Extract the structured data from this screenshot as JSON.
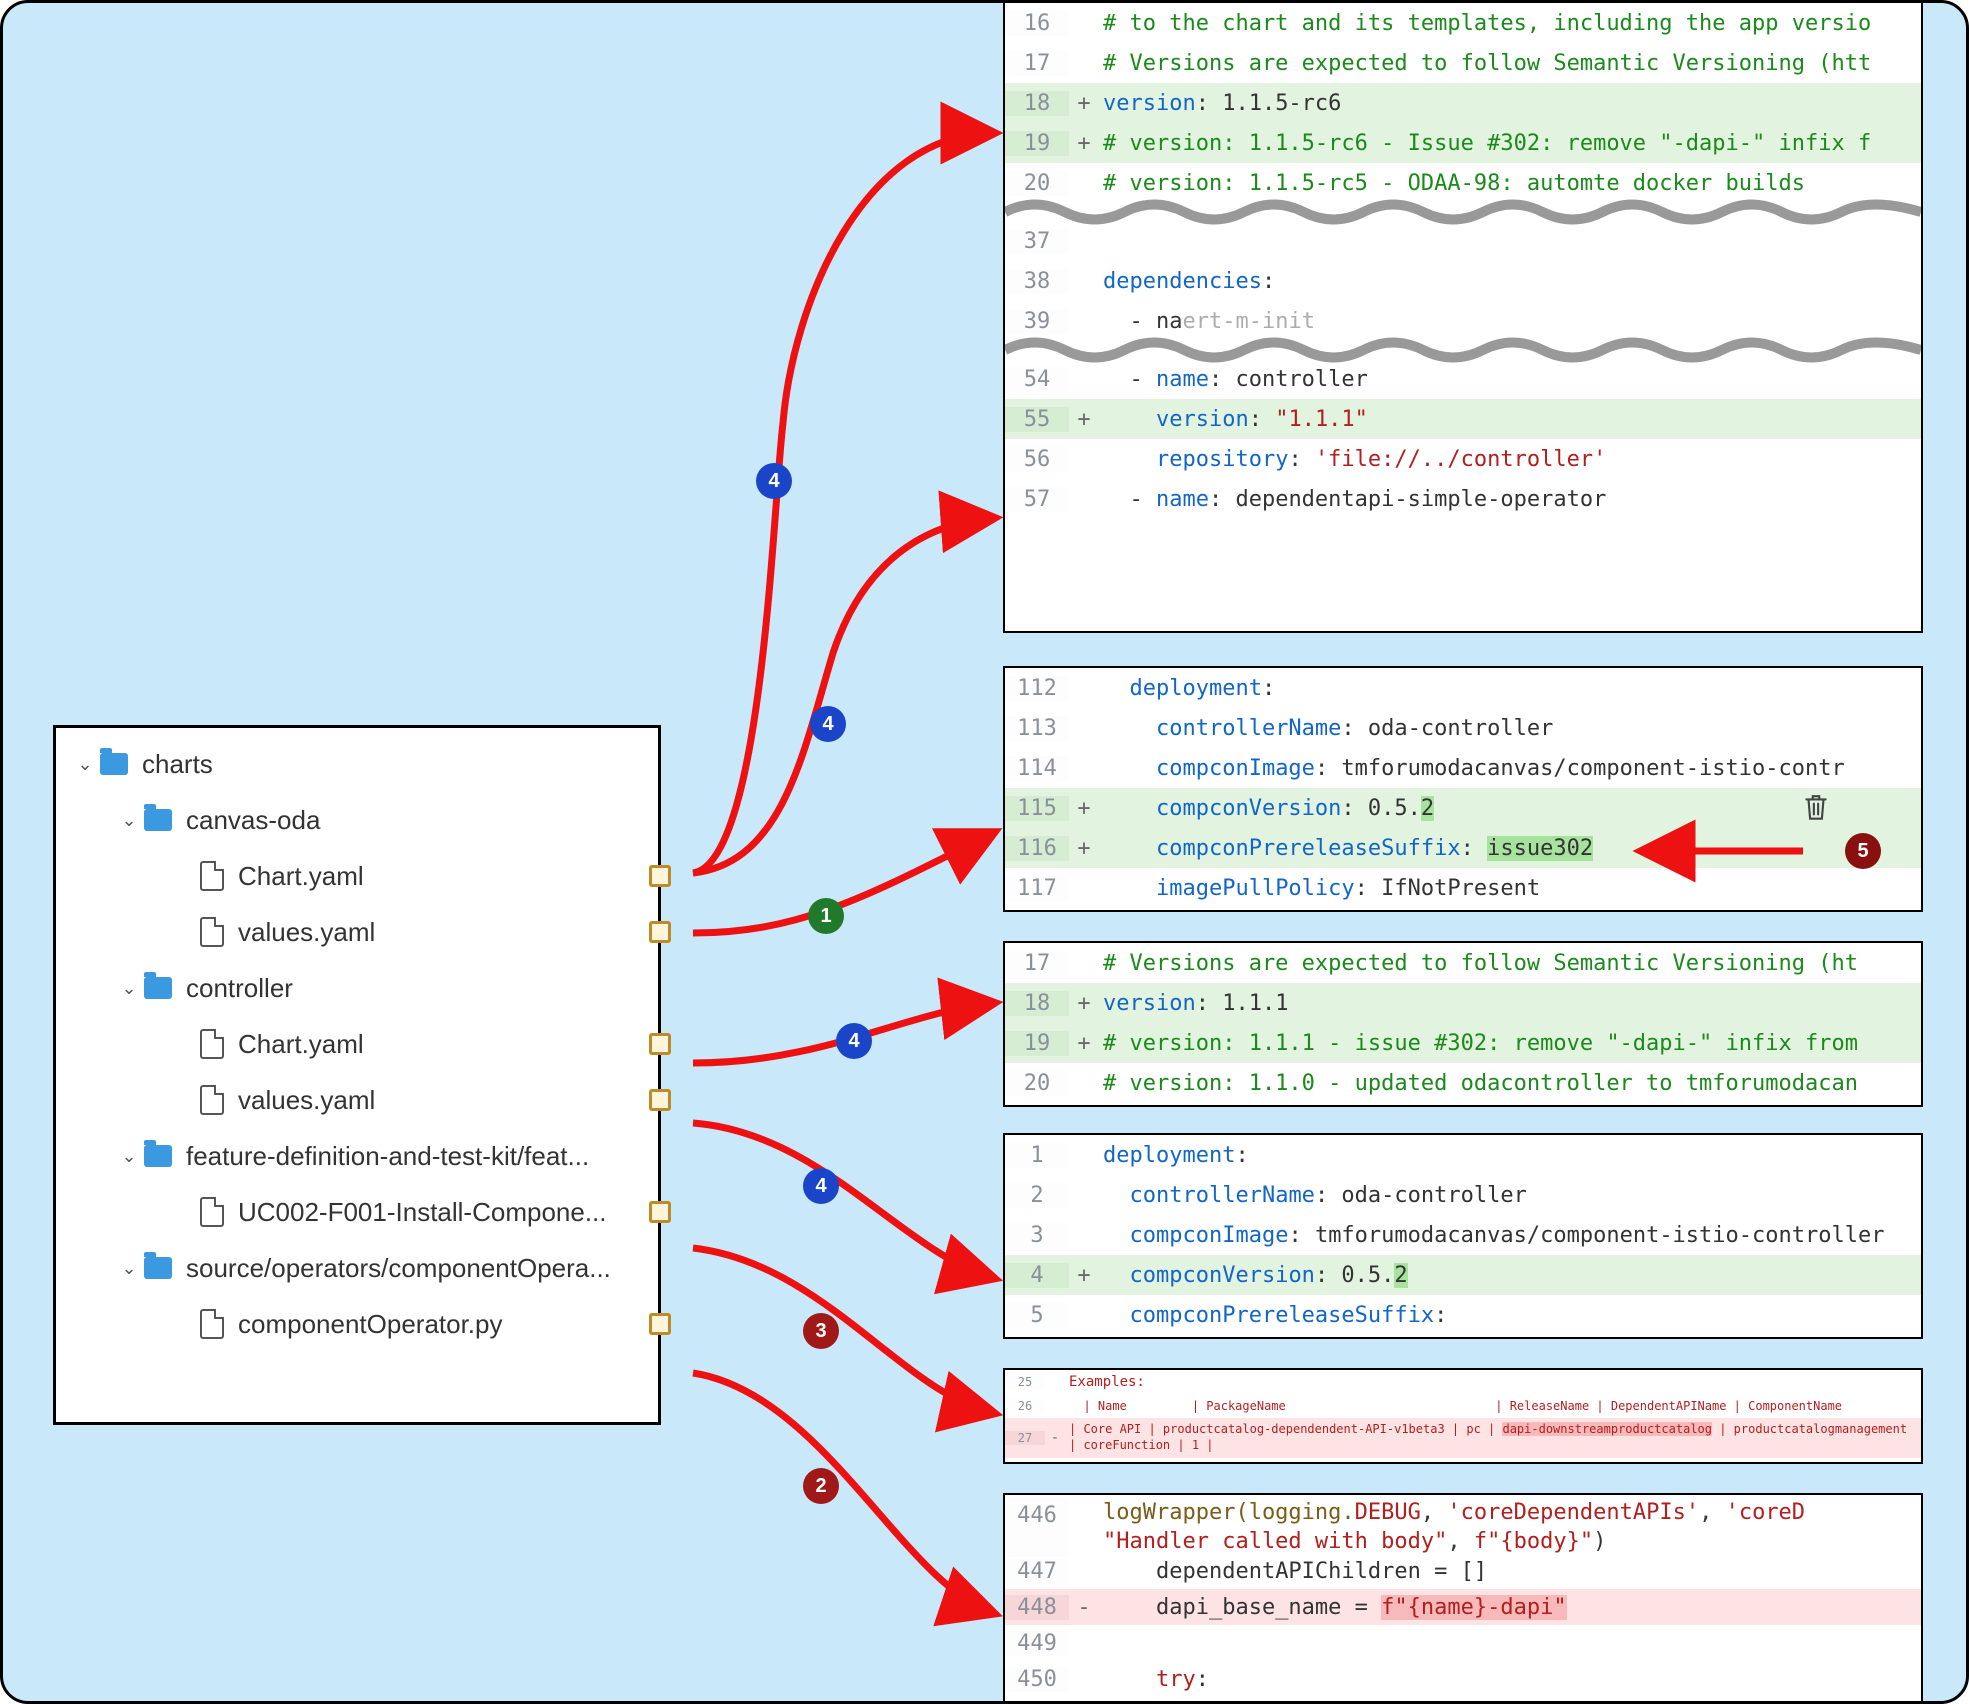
{
  "tree": {
    "root": "charts",
    "canvas_oda": "canvas-oda",
    "chart_yaml": "Chart.yaml",
    "values_yaml": "values.yaml",
    "controller": "controller",
    "feature_kit": "feature-definition-and-test-kit/feat...",
    "uc002": "UC002-F001-Install-Compone...",
    "source_ops": "source/operators/componentOpera...",
    "comp_operator": "componentOperator.py"
  },
  "p1": {
    "l16": "# to the chart and its templates, including the app versio",
    "l17": "# Versions are expected to follow Semantic Versioning (htt",
    "l18_k": "version",
    "l18_v": ": 1.1.5-rc6",
    "l19": "# version: 1.1.5-rc6 - Issue #302: remove \"-dapi-\" infix f",
    "l20": "# version: 1.1.5-rc5 - ODAA-98: automte docker builds",
    "ln37": "37",
    "l38_k": "dependencies",
    "l38_v": ":",
    "l39_a": "  - na",
    "l39_b": "ert-m",
    "l39_c": "-init",
    "ln54": "54",
    "l54_a": "  - ",
    "l54_k": "name",
    "l54_v": ": controller",
    "l55_k": "version",
    "l55_v": ": ",
    "l55_s": "\"1.1.1\"",
    "l56_k": "repository",
    "l56_v": ": ",
    "l56_s": "'file://../controller'",
    "l57_a": "  - ",
    "l57_k": "name",
    "l57_v": ": dependentapi-simple-operator"
  },
  "p2": {
    "l112_k": "deployment",
    "l112_v": ":",
    "l113_k": "controllerName",
    "l113_v": ": oda-controller",
    "l114_k": "compconImage",
    "l114_v": ": tmforumodacanvas/component-istio-contr",
    "l115_k": "compconVersion",
    "l115_v": ": 0.5.",
    "l115_h": "2",
    "l116_k": "compconPrereleaseSuffix",
    "l116_v": ": ",
    "l116_h": "issue302",
    "l117_k": "imagePullPolicy",
    "l117_v": ": IfNotPresent"
  },
  "p3": {
    "l17": "# Versions are expected to follow Semantic Versioning (ht",
    "l18_k": "version",
    "l18_v": ": 1.1.1",
    "l19": "# version: 1.1.1 - issue #302: remove \"-dapi-\" infix from",
    "l20": "# version: 1.1.0 - updated odacontroller to tmforumodacan"
  },
  "p4": {
    "l1_k": "deployment",
    "l1_v": ":",
    "l2_k": "controllerName",
    "l2_v": ": oda-controller",
    "l3_k": "compconImage",
    "l3_v": ": tmforumodacanvas/component-istio-controller",
    "l4_k": "compconVersion",
    "l4_v": ": 0.5.",
    "l4_h": "2",
    "l5_k": "compconPrereleaseSuffix",
    "l5_v": ":"
  },
  "p5": {
    "l25": "Examples:",
    "l26": "  | Name         | PackageName                             | ReleaseName | DependentAPIName | ComponentName            | SegmentName                 | DependentApiCount |",
    "l27a": "  | Core API     | productcatalog-dependendent-API-v1beta3 |    pc       | ",
    "l27h1": "dapi-",
    "l27h2": "downstreamproductcatalog",
    "l27b": " | productcatalogmanagement     | coreFunction      |   1    |"
  },
  "p6": {
    "l446a": "logWrapper(logging.",
    "l446b": "DEBUG",
    "l446c": ", ",
    "l446d": "'coreDependentAPIs'",
    "l446e": ", ",
    "l446f": "'coreD",
    "l446g": "\"Handler called with body\"",
    "l446h": ", ",
    "l446i": "f\"{body}\"",
    "l446j": ")",
    "l447": "dependentAPIChildren = []",
    "l448a": "dapi_base_name = ",
    "l448b": "f\"{name}-dapi\"",
    "l450": "try",
    "l450b": ":"
  },
  "ln": {
    "p1": [
      "16",
      "17",
      "18",
      "19",
      "20",
      "37",
      "38",
      "39",
      "54",
      "55",
      "56",
      "57"
    ],
    "p2": [
      "112",
      "113",
      "114",
      "115",
      "116",
      "117"
    ],
    "p3": [
      "17",
      "18",
      "19",
      "20"
    ],
    "p4": [
      "1",
      "2",
      "3",
      "4",
      "5"
    ],
    "p5": [
      "25",
      "26",
      "27"
    ],
    "p6": [
      "446",
      "447",
      "448",
      "449",
      "450"
    ]
  },
  "badges": {
    "b1": "1",
    "b2": "2",
    "b3": "3",
    "b4": "4",
    "b5": "5"
  }
}
